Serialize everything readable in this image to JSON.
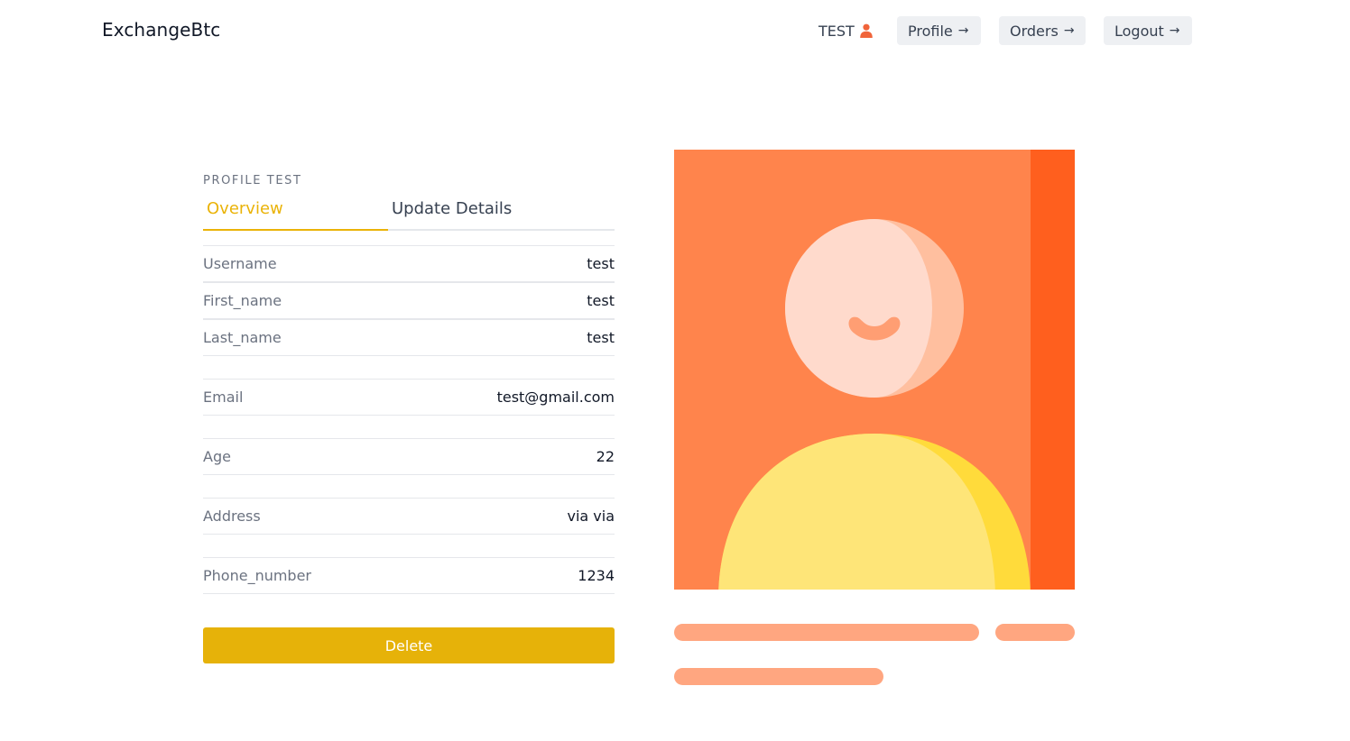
{
  "brand": "ExchangeBtc",
  "nav": {
    "user": "TEST",
    "profile": "Profile",
    "orders": "Orders",
    "logout": "Logout",
    "arrow": "→"
  },
  "profile": {
    "kicker": "PROFILE TEST",
    "tabs": [
      "Overview",
      "Update Details"
    ],
    "fields": [
      {
        "label": "Username",
        "value": "test"
      },
      {
        "label": "First_name",
        "value": "test"
      },
      {
        "label": "Last_name",
        "value": "test"
      },
      {
        "label": "Email",
        "value": "test@gmail.com"
      },
      {
        "label": "Age",
        "value": "22"
      },
      {
        "label": "Address",
        "value": "via via"
      },
      {
        "label": "Phone_number",
        "value": "1234"
      }
    ],
    "delete_label": "Delete"
  },
  "colors": {
    "accent": "#eab308",
    "delete_button": "#e6b209",
    "illustration_bg": "#ff844c",
    "illustration_strip": "#ff5f1e",
    "face": "#ffdacc",
    "body": "#fee578",
    "placeholder_bar": "#ffa680"
  },
  "icons": {
    "user": "user-icon",
    "arrow": "arrow-right-icon"
  }
}
